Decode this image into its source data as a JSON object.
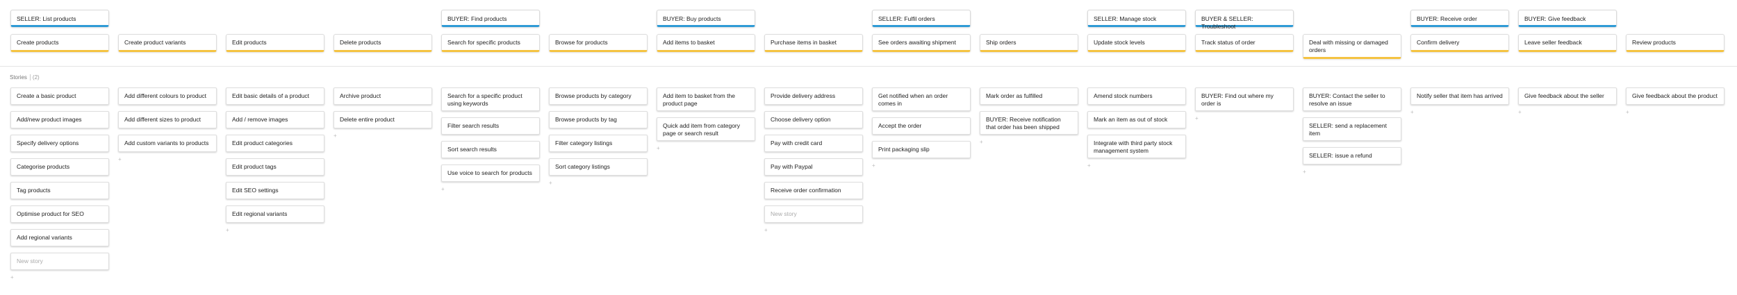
{
  "activities": [
    "SELLER: List products",
    "",
    "",
    "",
    "BUYER: Find products",
    "",
    "BUYER: Buy products",
    "",
    "SELLER: Fulfil orders",
    "",
    "SELLER: Manage stock",
    "BUYER & SELLER: Troubleshoot",
    "",
    "BUYER: Receive order",
    "BUYER: Give feedback",
    ""
  ],
  "tasks": [
    "Create products",
    "Create product variants",
    "Edit products",
    "Delete products",
    "Search for specific products",
    "Browse for products",
    "Add items to basket",
    "Purchase items in basket",
    "See orders awaiting shipment",
    "Ship orders",
    "Update stock levels",
    "Track status of order",
    "Deal with missing or damaged orders",
    "Confirm delivery",
    "Leave seller feedback",
    "Review products"
  ],
  "stories_section": {
    "label": "Stories",
    "count": "(2)"
  },
  "add_marker": "+",
  "stories": [
    [
      "Create a basic product",
      "Add/new product images",
      "Specify delivery options",
      "Categorise products",
      "Tag products",
      "Optimise product for SEO",
      "Add regional variants"
    ],
    [
      "Add different colours to product",
      "Add different sizes to product",
      "Add custom variants to products"
    ],
    [
      "Edit basic details of a product",
      "Add / remove images",
      "Edit product categories",
      "Edit product tags",
      "Edit SEO settings",
      "Edit regional variants"
    ],
    [
      "Archive product",
      "Delete entire product"
    ],
    [
      "Search for a specific product using keywords",
      "Filter search results",
      "Sort search results",
      "Use voice to search for products"
    ],
    [
      "Browse products by category",
      "Browse products by tag",
      "Filter category listings",
      "Sort category listings"
    ],
    [
      "Add item to basket from the product page",
      "Quick add item from category page or search result"
    ],
    [
      "Provide delivery address",
      "Choose delivery option",
      "Pay with credit card",
      "Pay with Paypal",
      "Receive order confirmation"
    ],
    [
      "Get notified when an order comes in",
      "Accept the order",
      "Print packaging slip"
    ],
    [
      "Mark order as fulfilled",
      "BUYER: Receive notification that order has been shipped"
    ],
    [
      "Amend stock numbers",
      "Mark an item as out of stock",
      "Integrate with third party stock management system"
    ],
    [
      "BUYER: Find out where my order is"
    ],
    [
      "BUYER: Contact the seller to resolve an issue",
      "SELLER: send a replacement item",
      "SELLER: issue a refund"
    ],
    [
      "Notify seller that item has arrived"
    ],
    [
      "Give feedback about the seller"
    ],
    [
      "Give feedback about the product"
    ]
  ],
  "new_story_columns": [
    0,
    7
  ],
  "new_story_label": "New story",
  "colors": {
    "activity_accent": "#2f9bd6",
    "task_accent": "#f5c342",
    "divider": "#e4e4e4"
  }
}
